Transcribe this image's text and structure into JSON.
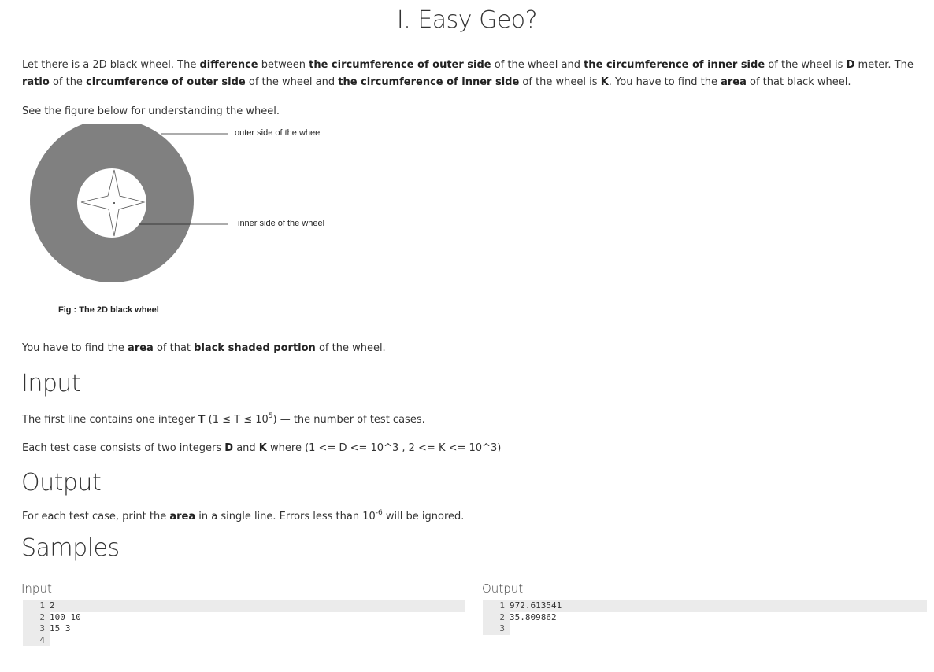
{
  "problem": {
    "title": "I. Easy Geo?",
    "intro": {
      "p1": "Let there is a 2D black wheel. The",
      "b1": "difference",
      "p2": "between",
      "b2": "the circumference of outer side",
      "p3": "of the wheel and",
      "b3": "the circumference of inner side",
      "p4": "of the wheel is",
      "b4": "D",
      "p5": "meter. The",
      "b5": "ratio",
      "p6": "of the",
      "b6": "circumference of outer side",
      "p7": "of the wheel and",
      "b7": "the circumference of inner side",
      "p8": "of the wheel is",
      "b8": "K",
      "p9": ". You have to find the",
      "b9": "area",
      "p10": "of that black wheel."
    },
    "see_figure": "See the figure below for understanding the wheel.",
    "figure": {
      "outer_label": "outer side of the wheel",
      "inner_label": "inner side of the wheel",
      "caption": "Fig : The 2D black wheel",
      "wheel_color": "#808080"
    },
    "find_area": {
      "p1": "You have to find the",
      "b1": "area",
      "p2": "of that",
      "b2": "black shaded portion",
      "p3": "of the wheel."
    },
    "input_heading": "Input",
    "input_line1": {
      "p1": "The first line contains one integer",
      "b1": "T",
      "p2": "(1 ≤ T ≤ 10",
      "sup": "5",
      "p3": ") — the number of test cases."
    },
    "input_line2": {
      "p1": "Each test case consists of two integers",
      "b1": "D",
      "p2": "and",
      "b2": "K",
      "p3": "where (1 <= D <= 10^3 , 2 <= K <= 10^3)"
    },
    "output_heading": "Output",
    "output_line": {
      "p1": "For each test case, print the",
      "b1": "area",
      "p2": "in a single line. Errors less than 10",
      "sup": "-6",
      "p3": "will be ignored."
    },
    "samples_heading": "Samples",
    "sample_input_label": "Input",
    "sample_output_label": "Output",
    "sample_input_lines": [
      {
        "n": "1",
        "t": "2"
      },
      {
        "n": "2",
        "t": "100 10"
      },
      {
        "n": "3",
        "t": "15 3"
      },
      {
        "n": "4",
        "t": ""
      }
    ],
    "sample_output_lines": [
      {
        "n": "1",
        "t": "972.613541"
      },
      {
        "n": "2",
        "t": "35.809862"
      },
      {
        "n": "3",
        "t": ""
      }
    ]
  }
}
